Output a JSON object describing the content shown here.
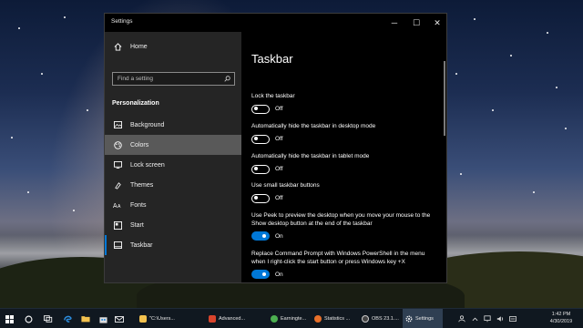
{
  "window": {
    "title": "Settings",
    "minimize": "─",
    "maximize": "☐",
    "close": "✕"
  },
  "nav": {
    "home": "Home",
    "search_placeholder": "Find a setting",
    "section_heading": "Personalization",
    "items": [
      {
        "label": "Background",
        "icon": "picture-icon"
      },
      {
        "label": "Colors",
        "icon": "palette-icon"
      },
      {
        "label": "Lock screen",
        "icon": "lock-screen-icon"
      },
      {
        "label": "Themes",
        "icon": "themes-icon"
      },
      {
        "label": "Fonts",
        "icon": "fonts-icon"
      },
      {
        "label": "Start",
        "icon": "start-icon"
      },
      {
        "label": "Taskbar",
        "icon": "taskbar-icon"
      }
    ],
    "selected": "Colors"
  },
  "main": {
    "title": "Taskbar",
    "settings": [
      {
        "label": "Lock the taskbar",
        "state": "Off",
        "on": false
      },
      {
        "label": "Automatically hide the taskbar in desktop mode",
        "state": "Off",
        "on": false
      },
      {
        "label": "Automatically hide the taskbar in tablet mode",
        "state": "Off",
        "on": false
      },
      {
        "label": "Use small taskbar buttons",
        "state": "Off",
        "on": false
      },
      {
        "label": "Use Peek to preview the desktop when you move your mouse to the Show desktop button at the end of the taskbar",
        "state": "On",
        "on": true
      },
      {
        "label": "Replace Command Prompt with Windows PowerShell in the menu when I right-click the start button or press Windows key +X",
        "state": "On",
        "on": true
      }
    ]
  },
  "taskbar": {
    "apps": [
      {
        "label": "\"C:\\Users...",
        "color": "#f2c14e"
      },
      {
        "label": "Advanced...",
        "color": "#d9442c"
      },
      {
        "label": "Earningte...",
        "color": "#4caf50"
      },
      {
        "label": "Statistics ...",
        "color": "#e8702a"
      },
      {
        "label": "OBS 23.1....",
        "color": "#444444"
      },
      {
        "label": "Settings",
        "color": "#777777"
      }
    ],
    "time": "1:42 PM",
    "date": "4/30/2019"
  },
  "colors": {
    "accent": "#0078d7"
  }
}
